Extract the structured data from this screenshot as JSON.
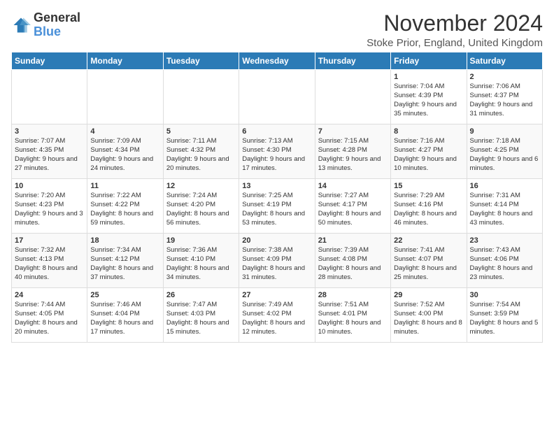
{
  "logo": {
    "line1": "General",
    "line2": "Blue"
  },
  "title": "November 2024",
  "subtitle": "Stoke Prior, England, United Kingdom",
  "days_of_week": [
    "Sunday",
    "Monday",
    "Tuesday",
    "Wednesday",
    "Thursday",
    "Friday",
    "Saturday"
  ],
  "weeks": [
    [
      {
        "day": "",
        "info": ""
      },
      {
        "day": "",
        "info": ""
      },
      {
        "day": "",
        "info": ""
      },
      {
        "day": "",
        "info": ""
      },
      {
        "day": "",
        "info": ""
      },
      {
        "day": "1",
        "info": "Sunrise: 7:04 AM\nSunset: 4:39 PM\nDaylight: 9 hours and 35 minutes."
      },
      {
        "day": "2",
        "info": "Sunrise: 7:06 AM\nSunset: 4:37 PM\nDaylight: 9 hours and 31 minutes."
      }
    ],
    [
      {
        "day": "3",
        "info": "Sunrise: 7:07 AM\nSunset: 4:35 PM\nDaylight: 9 hours and 27 minutes."
      },
      {
        "day": "4",
        "info": "Sunrise: 7:09 AM\nSunset: 4:34 PM\nDaylight: 9 hours and 24 minutes."
      },
      {
        "day": "5",
        "info": "Sunrise: 7:11 AM\nSunset: 4:32 PM\nDaylight: 9 hours and 20 minutes."
      },
      {
        "day": "6",
        "info": "Sunrise: 7:13 AM\nSunset: 4:30 PM\nDaylight: 9 hours and 17 minutes."
      },
      {
        "day": "7",
        "info": "Sunrise: 7:15 AM\nSunset: 4:28 PM\nDaylight: 9 hours and 13 minutes."
      },
      {
        "day": "8",
        "info": "Sunrise: 7:16 AM\nSunset: 4:27 PM\nDaylight: 9 hours and 10 minutes."
      },
      {
        "day": "9",
        "info": "Sunrise: 7:18 AM\nSunset: 4:25 PM\nDaylight: 9 hours and 6 minutes."
      }
    ],
    [
      {
        "day": "10",
        "info": "Sunrise: 7:20 AM\nSunset: 4:23 PM\nDaylight: 9 hours and 3 minutes."
      },
      {
        "day": "11",
        "info": "Sunrise: 7:22 AM\nSunset: 4:22 PM\nDaylight: 8 hours and 59 minutes."
      },
      {
        "day": "12",
        "info": "Sunrise: 7:24 AM\nSunset: 4:20 PM\nDaylight: 8 hours and 56 minutes."
      },
      {
        "day": "13",
        "info": "Sunrise: 7:25 AM\nSunset: 4:19 PM\nDaylight: 8 hours and 53 minutes."
      },
      {
        "day": "14",
        "info": "Sunrise: 7:27 AM\nSunset: 4:17 PM\nDaylight: 8 hours and 50 minutes."
      },
      {
        "day": "15",
        "info": "Sunrise: 7:29 AM\nSunset: 4:16 PM\nDaylight: 8 hours and 46 minutes."
      },
      {
        "day": "16",
        "info": "Sunrise: 7:31 AM\nSunset: 4:14 PM\nDaylight: 8 hours and 43 minutes."
      }
    ],
    [
      {
        "day": "17",
        "info": "Sunrise: 7:32 AM\nSunset: 4:13 PM\nDaylight: 8 hours and 40 minutes."
      },
      {
        "day": "18",
        "info": "Sunrise: 7:34 AM\nSunset: 4:12 PM\nDaylight: 8 hours and 37 minutes."
      },
      {
        "day": "19",
        "info": "Sunrise: 7:36 AM\nSunset: 4:10 PM\nDaylight: 8 hours and 34 minutes."
      },
      {
        "day": "20",
        "info": "Sunrise: 7:38 AM\nSunset: 4:09 PM\nDaylight: 8 hours and 31 minutes."
      },
      {
        "day": "21",
        "info": "Sunrise: 7:39 AM\nSunset: 4:08 PM\nDaylight: 8 hours and 28 minutes."
      },
      {
        "day": "22",
        "info": "Sunrise: 7:41 AM\nSunset: 4:07 PM\nDaylight: 8 hours and 25 minutes."
      },
      {
        "day": "23",
        "info": "Sunrise: 7:43 AM\nSunset: 4:06 PM\nDaylight: 8 hours and 23 minutes."
      }
    ],
    [
      {
        "day": "24",
        "info": "Sunrise: 7:44 AM\nSunset: 4:05 PM\nDaylight: 8 hours and 20 minutes."
      },
      {
        "day": "25",
        "info": "Sunrise: 7:46 AM\nSunset: 4:04 PM\nDaylight: 8 hours and 17 minutes."
      },
      {
        "day": "26",
        "info": "Sunrise: 7:47 AM\nSunset: 4:03 PM\nDaylight: 8 hours and 15 minutes."
      },
      {
        "day": "27",
        "info": "Sunrise: 7:49 AM\nSunset: 4:02 PM\nDaylight: 8 hours and 12 minutes."
      },
      {
        "day": "28",
        "info": "Sunrise: 7:51 AM\nSunset: 4:01 PM\nDaylight: 8 hours and 10 minutes."
      },
      {
        "day": "29",
        "info": "Sunrise: 7:52 AM\nSunset: 4:00 PM\nDaylight: 8 hours and 8 minutes."
      },
      {
        "day": "30",
        "info": "Sunrise: 7:54 AM\nSunset: 3:59 PM\nDaylight: 8 hours and 5 minutes."
      }
    ]
  ]
}
